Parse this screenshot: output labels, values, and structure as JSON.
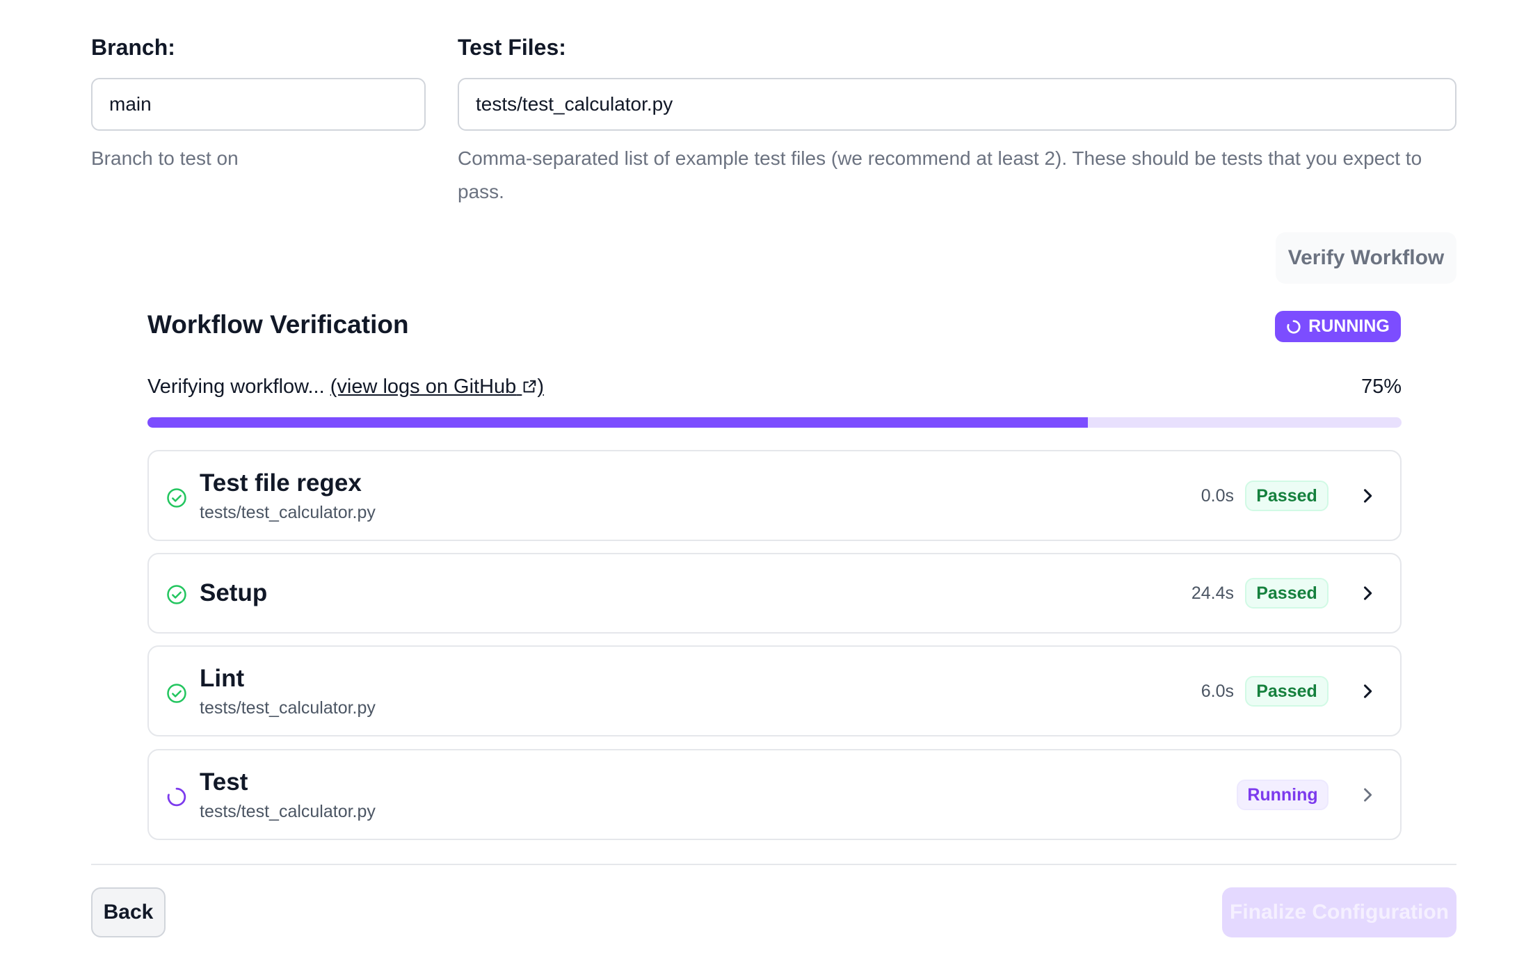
{
  "form": {
    "branch_label": "Branch:",
    "branch_value": "main",
    "branch_help": "Branch to test on",
    "test_files_label": "Test Files:",
    "test_files_value": "tests/test_calculator.py",
    "test_files_help": "Comma-separated list of example test files (we recommend at least 2). These should be tests that you expect to pass."
  },
  "verify_button": "Verify Workflow",
  "verification": {
    "title": "Workflow Verification",
    "status_badge": "RUNNING",
    "progress_text": "Verifying workflow...",
    "logs_link": "(view logs on GitHub",
    "logs_link_close": ")",
    "progress_percent_label": "75%",
    "progress": 0.75,
    "steps": [
      {
        "name": "Test file regex",
        "subtitle": "tests/test_calculator.py",
        "duration": "0.0s",
        "status": "Passed"
      },
      {
        "name": "Setup",
        "subtitle": "",
        "duration": "24.4s",
        "status": "Passed"
      },
      {
        "name": "Lint",
        "subtitle": "tests/test_calculator.py",
        "duration": "6.0s",
        "status": "Passed"
      },
      {
        "name": "Test",
        "subtitle": "tests/test_calculator.py",
        "duration": "",
        "status": "Running"
      }
    ]
  },
  "footer": {
    "back_label": "Back",
    "finalize_label": "Finalize Configuration"
  },
  "colors": {
    "accent": "#7c4dff",
    "passed_green": "#15803d",
    "running_purple": "#7c3aed"
  },
  "icons": {
    "passed": "check-circle-icon",
    "running": "spinner-icon",
    "expand": "chevron-right-icon",
    "external": "external-link-icon"
  }
}
